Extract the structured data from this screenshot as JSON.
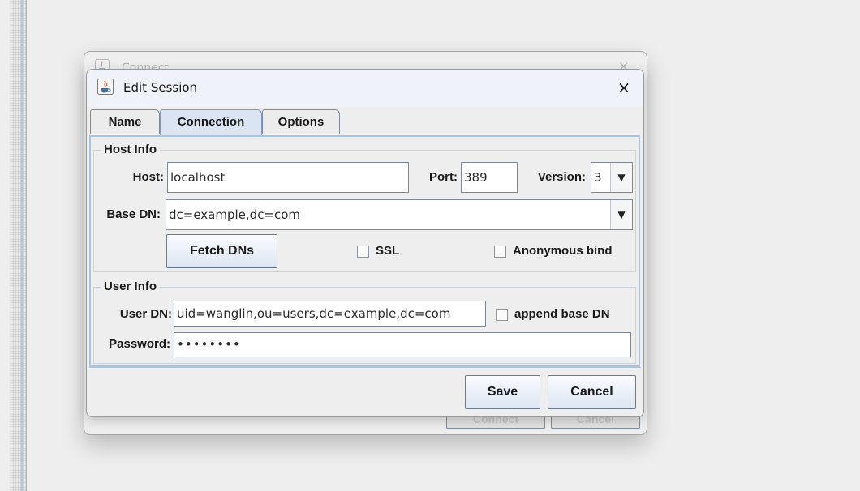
{
  "background_dialog": {
    "title": "Connect",
    "close": "×",
    "buttons": {
      "connect": "Connect",
      "cancel": "Cancel"
    }
  },
  "dialog": {
    "title": "Edit Session",
    "close": "×",
    "tabs": [
      "Name",
      "Connection",
      "Options"
    ],
    "active_tab": "Connection",
    "host_info": {
      "legend": "Host Info",
      "host_label": "Host:",
      "host_value": "localhost",
      "port_label": "Port:",
      "port_value": "389",
      "version_label": "Version:",
      "version_value": "3",
      "base_dn_label": "Base DN:",
      "base_dn_value": "dc=example,dc=com",
      "fetch_button": "Fetch DNs",
      "ssl_label": "SSL",
      "ssl_checked": false,
      "anonymous_label": "Anonymous bind",
      "anonymous_checked": false
    },
    "user_info": {
      "legend": "User Info",
      "user_dn_label": "User DN:",
      "user_dn_value": "uid=wanglin,ou=users,dc=example,dc=com",
      "append_label": "append base DN",
      "append_checked": false,
      "password_label": "Password:",
      "password_value": "••••••••"
    },
    "buttons": {
      "save": "Save",
      "cancel": "Cancel"
    }
  },
  "icons": {
    "app": "java-cup-icon",
    "dropdown": "chevron-down-icon",
    "close": "close-icon"
  },
  "colors": {
    "active_tab": "#dae4f2",
    "panel_border": "#a9c3e0",
    "titlebar": "#f0f2fa"
  }
}
